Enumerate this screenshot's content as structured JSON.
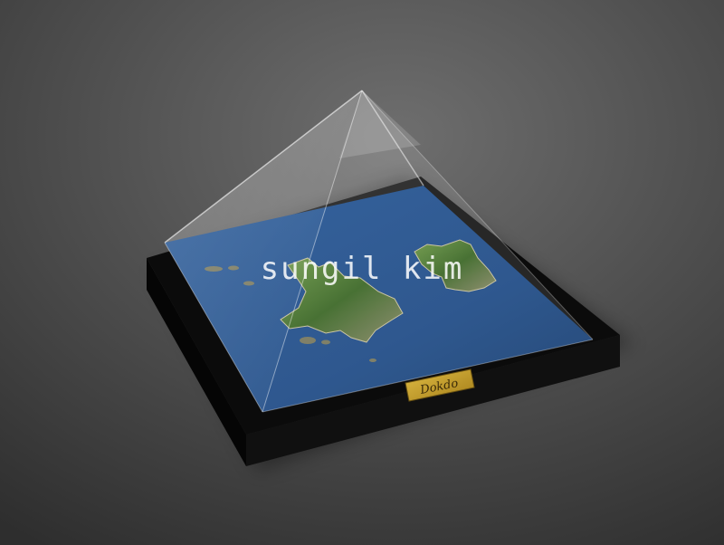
{
  "scene": {
    "subject": "glass-pyramid-island-model",
    "colors": {
      "background_light": "#6e6e6e",
      "background_dark": "#2e2e2e",
      "base": "#0b0b0b",
      "sea": "#24508a",
      "land": "#4f7a34",
      "plaque": "#c9a22a"
    }
  },
  "watermark": {
    "text": "sungil kim"
  },
  "plaque": {
    "text": "Dokdo"
  }
}
